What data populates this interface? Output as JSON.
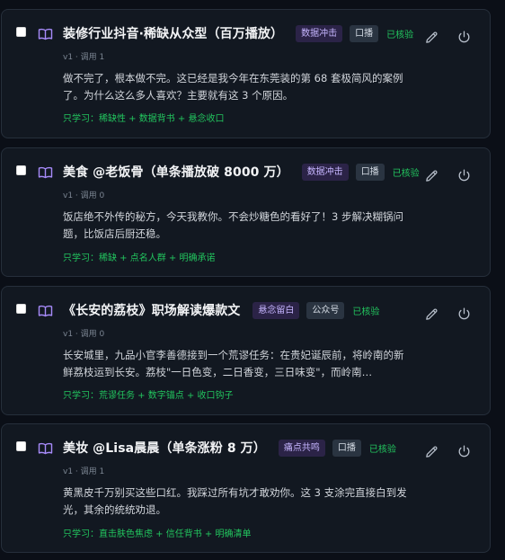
{
  "cards": [
    {
      "title": "装修行业抖音·稀缺从众型（百万播放）",
      "tags": [
        {
          "label": "数据冲击",
          "style": "purple"
        },
        {
          "label": "口播",
          "style": "gray"
        }
      ],
      "status": "已核验",
      "meta": "v1 · 调用 1",
      "body": "做不完了，根本做不完。这已经是我今年在东莞装的第 68 套极简风的案例了。为什么这么多人喜欢？主要就有这 3 个原因。",
      "learn": "只学习：稀缺性 + 数据背书 + 悬念收口"
    },
    {
      "title": "美食 @老饭骨（单条播放破 8000 万）",
      "tags": [
        {
          "label": "数据冲击",
          "style": "purple"
        },
        {
          "label": "口播",
          "style": "gray"
        }
      ],
      "status": "已核验",
      "meta": "v1 · 调用 0",
      "body": "饭店绝不外传的秘方，今天我教你。不会炒糖色的看好了！3 步解决糊锅问题，比饭店后厨还稳。",
      "learn": "只学习：稀缺 + 点名人群 + 明确承诺"
    },
    {
      "title": "《长安的荔枝》职场解读爆款文",
      "tags": [
        {
          "label": "悬念留白",
          "style": "purple"
        },
        {
          "label": "公众号",
          "style": "gray"
        }
      ],
      "status": "已核验",
      "meta": "v1 · 调用 0",
      "body": "长安城里，九品小官李善德接到一个荒谬任务：在贵妃诞辰前，将岭南的新鲜荔枝运到长安。荔枝\"一日色变，二日香变，三日味变\"，而岭南…",
      "learn": "只学习：荒谬任务 + 数字锚点 + 收口钩子"
    },
    {
      "title": "美妆 @Lisa晨晨（单条涨粉 8 万）",
      "tags": [
        {
          "label": "痛点共鸣",
          "style": "purple"
        },
        {
          "label": "口播",
          "style": "gray"
        }
      ],
      "status": "已核验",
      "meta": "v1 · 调用 1",
      "body": "黄黑皮千万别买这些口红。我踩过所有坑才敢劝你。这 3 支涂完直接白到发光，其余的统统劝退。",
      "learn": "只学习：直击肤色焦虑 + 信任背书 + 明确清单"
    }
  ],
  "icons": {
    "checkbox": "checkbox",
    "book": "book-open-icon",
    "edit": "pencil-icon",
    "toggle": "power-icon"
  },
  "colors": {
    "background": "#0b0f17",
    "card": "#121821",
    "accent_green": "#22c55e",
    "tag_purple": "#2b2347",
    "tag_gray": "#2a3441",
    "book_icon": "#a78bfa"
  }
}
